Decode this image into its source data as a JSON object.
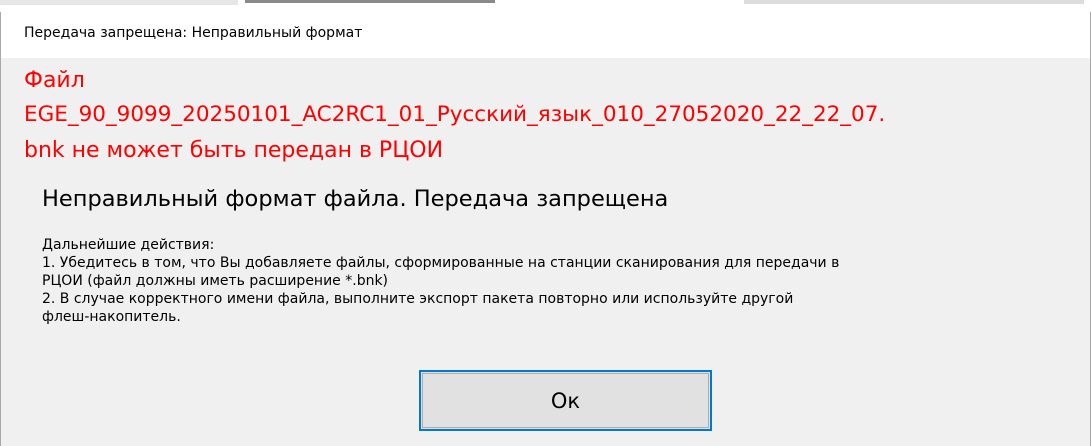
{
  "window": {
    "title": "Передача запрещена: Неправильный формат"
  },
  "error": {
    "line1": "Файл",
    "line2": "EGE_90_9099_20250101_AC2RC1_01_Русский_язык_010_27052020_22_22_07.",
    "line3": "bnk не может быть передан в РЦОИ",
    "color": "#ff0000"
  },
  "heading": "Неправильный формат файла. Передача запрещена",
  "instructions": {
    "lines": [
      "Дальнейшие действия:",
      "1. Убедитесь в том, что Вы добавляете файлы, сформированные на станции сканирования для передачи в",
      "РЦОИ (файл должны иметь расширение *.bnk)",
      "2. В случае корректного имени файла, выполните экспорт пакета повторно или используйте другой",
      "флеш-накопитель."
    ]
  },
  "buttons": {
    "ok_label": "Ок"
  },
  "colors": {
    "accent": "#0078d7",
    "background": "#f0f0f0"
  }
}
